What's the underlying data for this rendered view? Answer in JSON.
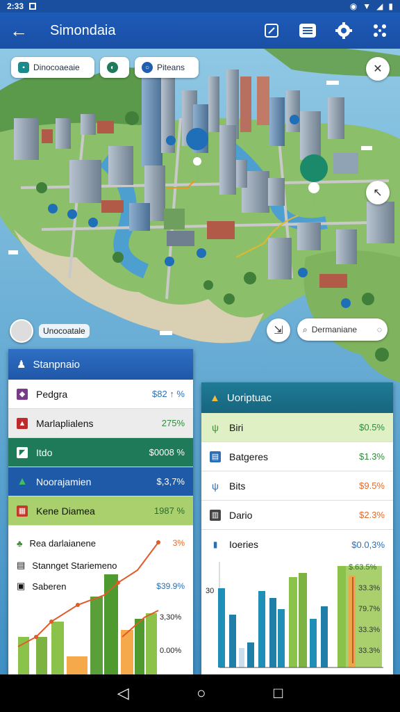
{
  "status": {
    "time": "2:33"
  },
  "app": {
    "title": "Simondaia"
  },
  "map": {
    "chips": [
      {
        "label": "Dinocoaeaie"
      },
      {
        "label": ""
      },
      {
        "label": "Piteans"
      }
    ],
    "location_label": "Unocoatale",
    "search_label": "Dermaniane"
  },
  "left_panel": {
    "title": "Stanpnaio",
    "rows": [
      {
        "label": "Pedgra",
        "value": "$82 ↑ %"
      },
      {
        "label": "Marlaplialens",
        "value": "275%"
      },
      {
        "label": "Itdo",
        "value": "$0008 %"
      },
      {
        "label": "Noorajamien",
        "value": "$,3,7%"
      },
      {
        "label": "Kene Diamea",
        "value": "1987 %"
      }
    ],
    "legend": [
      {
        "label": "Rea darlaianene",
        "value": "3%"
      },
      {
        "label": "Stannget Stariemeno",
        "value": ""
      },
      {
        "label": "Saberen",
        "value": "$39.9%"
      }
    ],
    "extra_values": [
      "3,30%",
      "0.00%"
    ]
  },
  "right_panel": {
    "title": "Uoriptuac",
    "rows": [
      {
        "label": "Biri",
        "value": "$0.5%"
      },
      {
        "label": "Batgeres",
        "value": "$1.3%"
      },
      {
        "label": "Bits",
        "value": "$9.5%"
      },
      {
        "label": "Dario",
        "value": "$2.3%"
      },
      {
        "label": "Ioeries",
        "value": "$0.0,3%"
      }
    ],
    "axis_label": "30",
    "side_values": [
      "$.63.5%",
      "33.3%",
      "79.7%",
      "33.3%",
      "33.3%"
    ]
  },
  "colors": {
    "accent": "#1d5bb8",
    "green_dark": "#1f7a5a",
    "blue_dark": "#1e5aa8",
    "green_light": "#a9d06c",
    "value_green": "#2e8b3a",
    "value_orange": "#e06a2a"
  }
}
